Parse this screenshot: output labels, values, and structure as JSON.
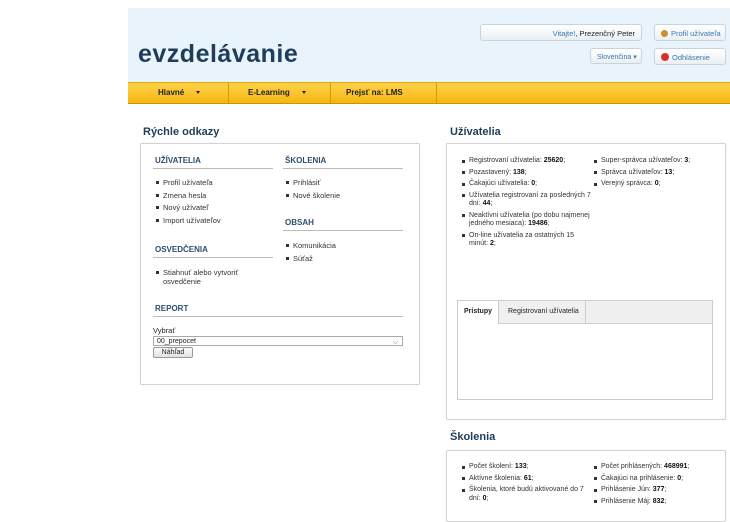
{
  "header": {
    "logo": "evzdelávanie",
    "welcome_greeting": "Vitajte!",
    "welcome_name": "Prezenčný Peter",
    "profile_label": "Profil užívateľa",
    "language_label": "Slovenčina",
    "logout_label": "Odhlásenie"
  },
  "nav": {
    "items": [
      {
        "label": "Hlavné"
      },
      {
        "label": "E-Learning"
      },
      {
        "label": "Prejsť na: LMS"
      }
    ]
  },
  "quick_links": {
    "title": "Rýchle odkazy",
    "users": {
      "heading": "UŽÍVATELIA",
      "items": [
        "Profil užívateľa",
        "Zmena hesla",
        "Nový užívateľ",
        "Import užívateľov"
      ]
    },
    "certificates": {
      "heading": "OSVEDČENIA",
      "items": [
        "Stiahnuť alebo vytvoriť osvedčenie"
      ]
    },
    "report": {
      "heading": "REPORT",
      "select_label": "Vybrať",
      "select_value": "00_prepocet",
      "button_label": "Náhľad"
    },
    "trainings": {
      "heading": "ŠKOLENIA",
      "items": [
        "Prihlásiť",
        "Nové školenie"
      ]
    },
    "content": {
      "heading": "OBSAH",
      "items": [
        "Komunikácia",
        "Súťaž"
      ]
    }
  },
  "users_panel": {
    "title": "Užívatelia",
    "left_stats": [
      {
        "label": "Registrovaní užívatelia:",
        "value": "25620"
      },
      {
        "label": "Pozastavený:",
        "value": "138"
      },
      {
        "label": "Čakajúci užívatelia:",
        "value": "0"
      },
      {
        "label": "Užívatelia registrovaní za posledných 7 dní",
        "value": "44"
      },
      {
        "label": "Neaktívni užívatelia (po dobu najmenej jedného mesiaca):",
        "value": "19486"
      },
      {
        "label": "On-line užívatelia za ostatných 15 minút:",
        "value": "2"
      }
    ],
    "right_stats": [
      {
        "label": "Super-správca užívateľov:",
        "value": "3"
      },
      {
        "label": "Správca užívateľov:",
        "value": "13"
      },
      {
        "label": "Verejný správca:",
        "value": "0"
      }
    ],
    "tabs": [
      "Prístupy",
      "Registrovaní užívatelia"
    ]
  },
  "trainings_panel": {
    "title": "Školenia",
    "left_stats": [
      {
        "label": "Počet školení:",
        "value": "133"
      },
      {
        "label": "Aktívne školenia:",
        "value": "61"
      },
      {
        "label": "Školenia, ktoré budú aktivované do 7 dní:",
        "value": "0"
      }
    ],
    "right_stats": [
      {
        "label": "Počet prihlásených:",
        "value": "468991"
      },
      {
        "label": "Čakajúci na prihlásenie:",
        "value": "0"
      },
      {
        "label": "Prihlásenie Jún:",
        "value": "377"
      },
      {
        "label": "Prihlásenie Máj:",
        "value": "832"
      }
    ]
  }
}
